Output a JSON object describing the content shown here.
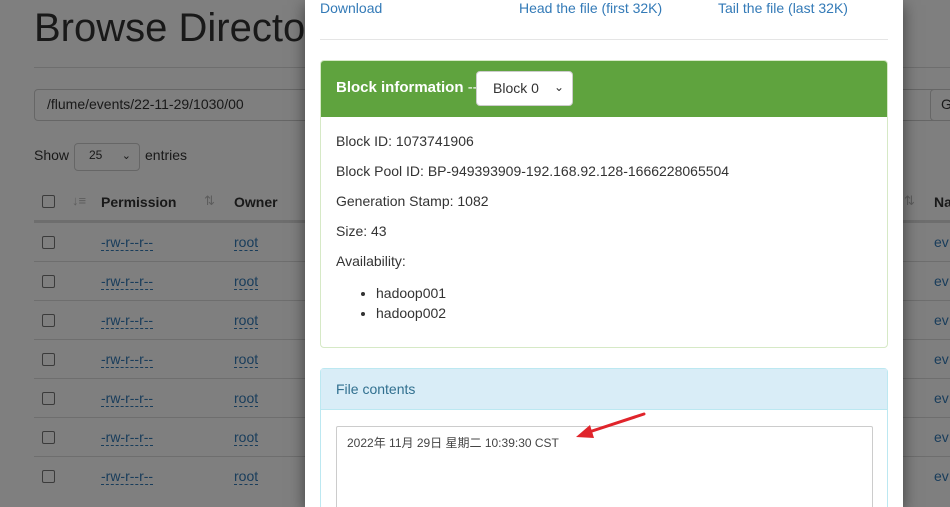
{
  "background": {
    "page_title": "Browse Director",
    "path_value": "/flume/events/22-11-29/1030/00",
    "go_label": "G",
    "show_label": "Show",
    "entries_value": "25",
    "entries_label": "entries",
    "columns": {
      "permission": "Permission",
      "owner": "Owner",
      "name": "Na"
    },
    "rows": [
      {
        "permission": "-rw-r--r--",
        "owner": "root",
        "name": "ev"
      },
      {
        "permission": "-rw-r--r--",
        "owner": "root",
        "name": "ev"
      },
      {
        "permission": "-rw-r--r--",
        "owner": "root",
        "name": "ev"
      },
      {
        "permission": "-rw-r--r--",
        "owner": "root",
        "name": "ev"
      },
      {
        "permission": "-rw-r--r--",
        "owner": "root",
        "name": "ev"
      },
      {
        "permission": "-rw-r--r--",
        "owner": "root",
        "name": "ev"
      },
      {
        "permission": "-rw-r--r--",
        "owner": "root",
        "name": "ev"
      }
    ]
  },
  "modal": {
    "links": {
      "download": "Download",
      "head": "Head the file (first 32K)",
      "tail": "Tail the file (last 32K)"
    },
    "block_panel": {
      "title": "Block information",
      "separator": "--",
      "selected_block": "Block 0",
      "block_id": "Block ID: 1073741906",
      "block_pool_id": "Block Pool ID: BP-949393909-192.168.92.128-1666228065504",
      "generation_stamp": "Generation Stamp: 1082",
      "size": "Size: 43",
      "availability_label": "Availability:",
      "hosts": [
        "hadoop001",
        "hadoop002"
      ]
    },
    "file_panel": {
      "title": "File contents",
      "content": "2022年 11月 29日 星期二 10:39:30 CST"
    }
  },
  "colors": {
    "link": "#337ab7",
    "block_header": "#5fa33e",
    "file_header": "#d9edf7",
    "annotation_arrow": "#e0242b"
  }
}
